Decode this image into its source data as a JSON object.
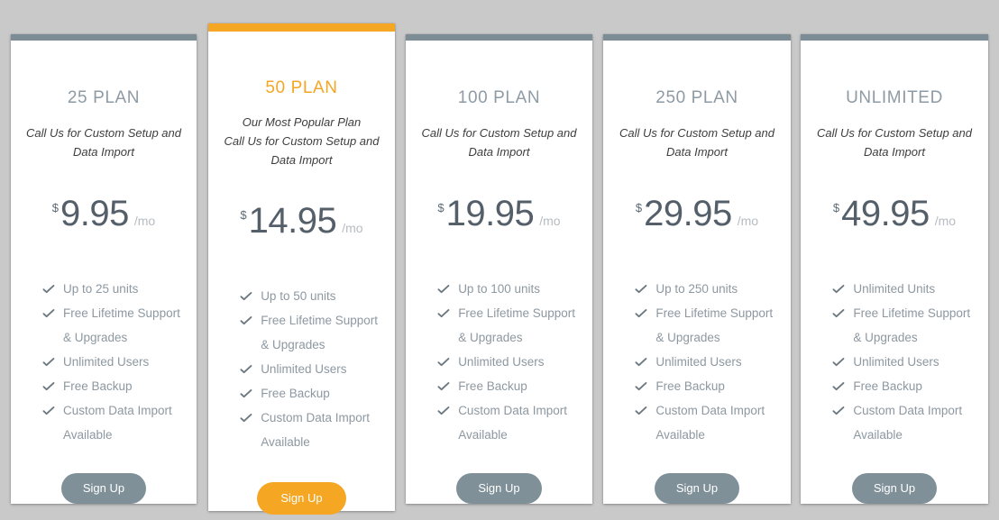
{
  "theme": {
    "page_background": "#c9c9c9",
    "card_background": "#ffffff",
    "accent": "#f5a623",
    "standard_bar": "#7c8d96",
    "title_color": "#8e9ba5",
    "price_color": "#545f69",
    "feature_color": "#8d98a1",
    "button_color": "#7f9099"
  },
  "icons": {
    "check": "check-icon"
  },
  "plans": [
    {
      "id": "plan-25",
      "title": "25 PLAN",
      "featured": false,
      "popular_note": "",
      "subtitle": "Call Us for Custom Setup and Data Import",
      "currency": "$",
      "price": "9.95",
      "period": "/mo",
      "features": [
        "Up to 25 units",
        "Free Lifetime Support & Upgrades",
        "Unlimited Users",
        "Free Backup",
        "Custom Data Import Available"
      ],
      "cta": "Sign Up"
    },
    {
      "id": "plan-50",
      "title": "50 PLAN",
      "featured": true,
      "popular_note": "Our Most Popular Plan",
      "subtitle": "Call Us for Custom Setup and Data Import",
      "currency": "$",
      "price": "14.95",
      "period": "/mo",
      "features": [
        "Up to 50 units",
        "Free Lifetime Support & Upgrades",
        "Unlimited Users",
        "Free Backup",
        "Custom Data Import Available"
      ],
      "cta": "Sign Up"
    },
    {
      "id": "plan-100",
      "title": "100 PLAN",
      "featured": false,
      "popular_note": "",
      "subtitle": "Call Us for Custom Setup and Data Import",
      "currency": "$",
      "price": "19.95",
      "period": "/mo",
      "features": [
        "Up to 100 units",
        "Free Lifetime Support & Upgrades",
        "Unlimited Users",
        "Free Backup",
        "Custom Data Import Available"
      ],
      "cta": "Sign Up"
    },
    {
      "id": "plan-250",
      "title": "250 PLAN",
      "featured": false,
      "popular_note": "",
      "subtitle": "Call Us for Custom Setup and Data Import",
      "currency": "$",
      "price": "29.95",
      "period": "/mo",
      "features": [
        "Up to 250 units",
        "Free Lifetime Support & Upgrades",
        "Unlimited Users",
        "Free Backup",
        "Custom Data Import Available"
      ],
      "cta": "Sign Up"
    },
    {
      "id": "plan-unlimited",
      "title": "UNLIMITED",
      "featured": false,
      "popular_note": "",
      "subtitle": "Call Us for Custom Setup and Data Import",
      "currency": "$",
      "price": "49.95",
      "period": "/mo",
      "features": [
        "Unlimited Units",
        "Free Lifetime Support & Upgrades",
        "Unlimited Users",
        "Free Backup",
        "Custom Data Import Available"
      ],
      "cta": "Sign Up"
    }
  ]
}
